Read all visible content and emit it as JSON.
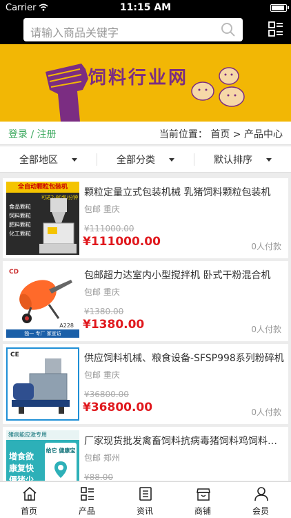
{
  "status": {
    "carrier": "Carrier",
    "time": "11:15 AM"
  },
  "search": {
    "placeholder": "请输入商品关键字"
  },
  "banner": {
    "title": "饲料行业网"
  },
  "breadcrumb": {
    "login": "登录 / 注册",
    "location": "当前位置：  首页 > 产品中心"
  },
  "filters": [
    {
      "label": "全部地区"
    },
    {
      "label": "全部分类"
    },
    {
      "label": "默认排序"
    }
  ],
  "products": [
    {
      "title": "颗粒定量立式包装机械 乳猪饲料颗粒包装机",
      "location": "包邮 重庆",
      "old_price": "¥111000.00",
      "price": "¥111000.00",
      "buyers": "0人付款",
      "image_text": {
        "header": "全自动颗粒包装机",
        "speed": "可达2-80包/分钟",
        "items": [
          "食品颗粒",
          "饲料颗粒",
          "肥料颗粒",
          "化工颗粒"
        ]
      }
    },
    {
      "title": "包邮超力达室内小型搅拌机 卧式干粉混合机",
      "location": "包邮 重庆",
      "old_price": "¥1380.00",
      "price": "¥1380.00",
      "buyers": "0人付款",
      "image_text": {
        "model": "A228",
        "footer": "独一 专厂 家宣访"
      }
    },
    {
      "title": "供应饲料机械、粮食设备-SFSP998系列粉碎机",
      "location": "包邮 重庆",
      "old_price": "¥36800.00",
      "price": "¥36800.00",
      "buyers": "0人付款",
      "image_text": {
        "mark": "CE"
      }
    },
    {
      "title": "厂家现货批发禽畜饲料抗病毒猪饲料鸡饲料添加剂",
      "location": "包邮 郑州",
      "old_price": "¥88.00",
      "price": "",
      "buyers": "",
      "image_text": {
        "header": "猪病能应激专用",
        "lines": [
          "增食欲",
          "康复快",
          "僵猪少"
        ],
        "brand": "给它 健康宝"
      }
    }
  ],
  "tabs": [
    {
      "label": "首页",
      "icon": "home-icon"
    },
    {
      "label": "产品",
      "icon": "grid-icon"
    },
    {
      "label": "资讯",
      "icon": "news-icon"
    },
    {
      "label": "商铺",
      "icon": "shop-icon"
    },
    {
      "label": "会员",
      "icon": "user-icon"
    }
  ],
  "colors": {
    "banner": "#f2b705",
    "banner_text": "#7b2d82",
    "login": "#39a85c",
    "price": "#e0181d"
  }
}
